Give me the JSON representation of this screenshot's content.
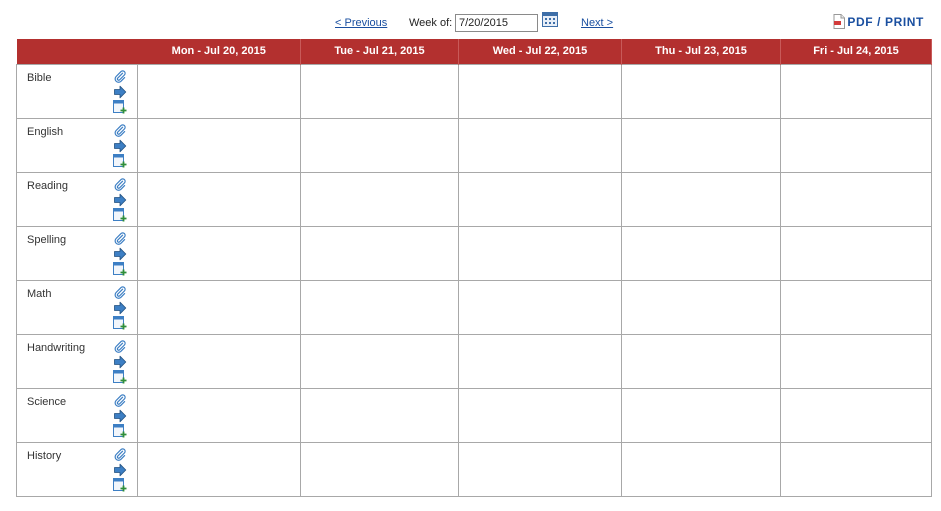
{
  "nav": {
    "previous_label": "< Previous",
    "week_label": "Week of:",
    "week_value": "7/20/2015",
    "next_label": "Next >",
    "pdf_label": "PDF / PRINT"
  },
  "colors": {
    "header_bg": "#b3302f",
    "link": "#1a4fa0",
    "border": "#a8a8a8",
    "icon_blue": "#3d7fc4"
  },
  "days": [
    {
      "label": "Mon - Jul 20, 2015"
    },
    {
      "label": "Tue - Jul 21, 2015"
    },
    {
      "label": "Wed - Jul 22, 2015"
    },
    {
      "label": "Thu - Jul 23, 2015"
    },
    {
      "label": "Fri - Jul 24, 2015"
    }
  ],
  "subjects": [
    {
      "name": "Bible"
    },
    {
      "name": "English"
    },
    {
      "name": "Reading"
    },
    {
      "name": "Spelling"
    },
    {
      "name": "Math"
    },
    {
      "name": "Handwriting"
    },
    {
      "name": "Science"
    },
    {
      "name": "History"
    }
  ],
  "row_icons": [
    "paperclip-icon",
    "arrow-right-icon",
    "add-lesson-icon"
  ]
}
